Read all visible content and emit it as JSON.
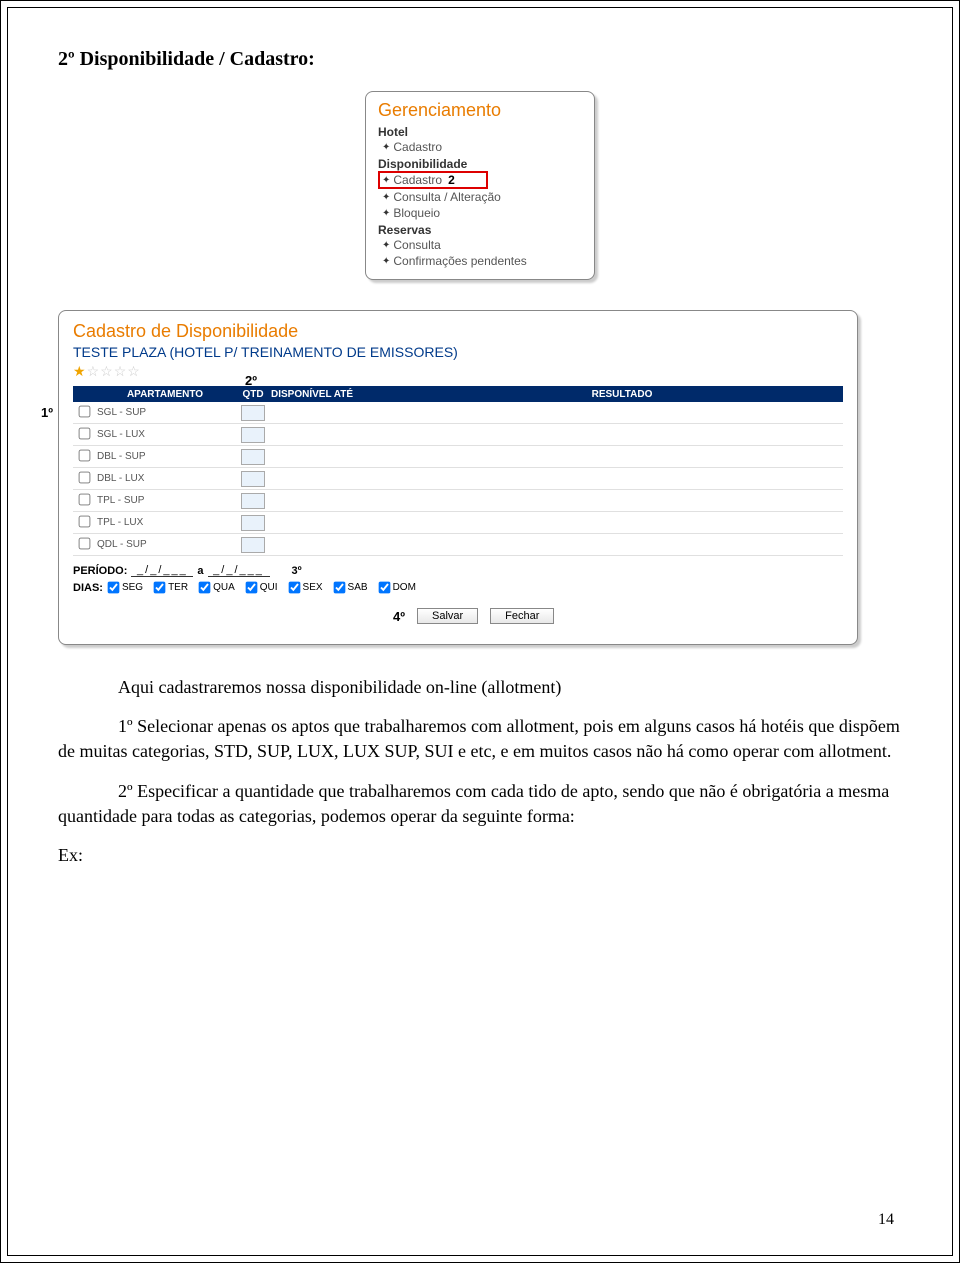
{
  "section_title": "2º Disponibilidade / Cadastro:",
  "menu": {
    "title": "Gerenciamento",
    "groups": [
      {
        "label": "Hotel",
        "items": [
          {
            "text": "Cadastro",
            "highlighted": false
          }
        ]
      },
      {
        "label": "Disponibilidade",
        "items": [
          {
            "text": "Cadastro",
            "highlighted": true,
            "step": "2"
          },
          {
            "text": "Consulta / Alteração",
            "highlighted": false
          },
          {
            "text": "Bloqueio",
            "highlighted": false
          }
        ]
      },
      {
        "label": "Reservas",
        "items": [
          {
            "text": "Consulta",
            "highlighted": false
          },
          {
            "text": "Confirmações pendentes",
            "highlighted": false
          }
        ]
      }
    ]
  },
  "form": {
    "title": "Cadastro de Disponibilidade",
    "hotel": "TESTE PLAZA (HOTEL P/ TREINAMENTO DE EMISSORES)",
    "stars_filled": 1,
    "stars_total": 5,
    "headers": {
      "apt": "APARTAMENTO",
      "qtd": "QTD",
      "disp": "DISPONÍVEL ATÉ",
      "res": "RESULTADO"
    },
    "rows": [
      {
        "label": "SGL - SUP"
      },
      {
        "label": "SGL - LUX"
      },
      {
        "label": "DBL - SUP"
      },
      {
        "label": "DBL - LUX"
      },
      {
        "label": "TPL - SUP"
      },
      {
        "label": "TPL - LUX"
      },
      {
        "label": "QDL - SUP"
      }
    ],
    "period_label": "PERÍODO:",
    "period_from": "_/_/___",
    "period_sep": "a",
    "period_to": "_/_/___",
    "days_label": "DIAS:",
    "days": [
      "SEG",
      "TER",
      "QUA",
      "QUI",
      "SEX",
      "SAB",
      "DOM"
    ],
    "btn_save": "Salvar",
    "btn_close": "Fechar",
    "markers": {
      "m1": "1º",
      "m2": "2º",
      "m3": "3º",
      "m4": "4º"
    }
  },
  "paragraphs": {
    "p1": "Aqui cadastraremos nossa disponibilidade on-line (allotment)",
    "p2": "1º Selecionar apenas os aptos que trabalharemos com allotment, pois em alguns casos há hotéis que dispõem de muitas categorias, STD, SUP, LUX, LUX SUP, SUI e etc, e em muitos casos não há como operar com allotment.",
    "p3": "2º Especificar a quantidade que trabalharemos com cada tido de apto, sendo que não é obrigatória a mesma quantidade para todas as categorias, podemos operar da seguinte forma:",
    "p4": "Ex:"
  },
  "page_number": "14"
}
